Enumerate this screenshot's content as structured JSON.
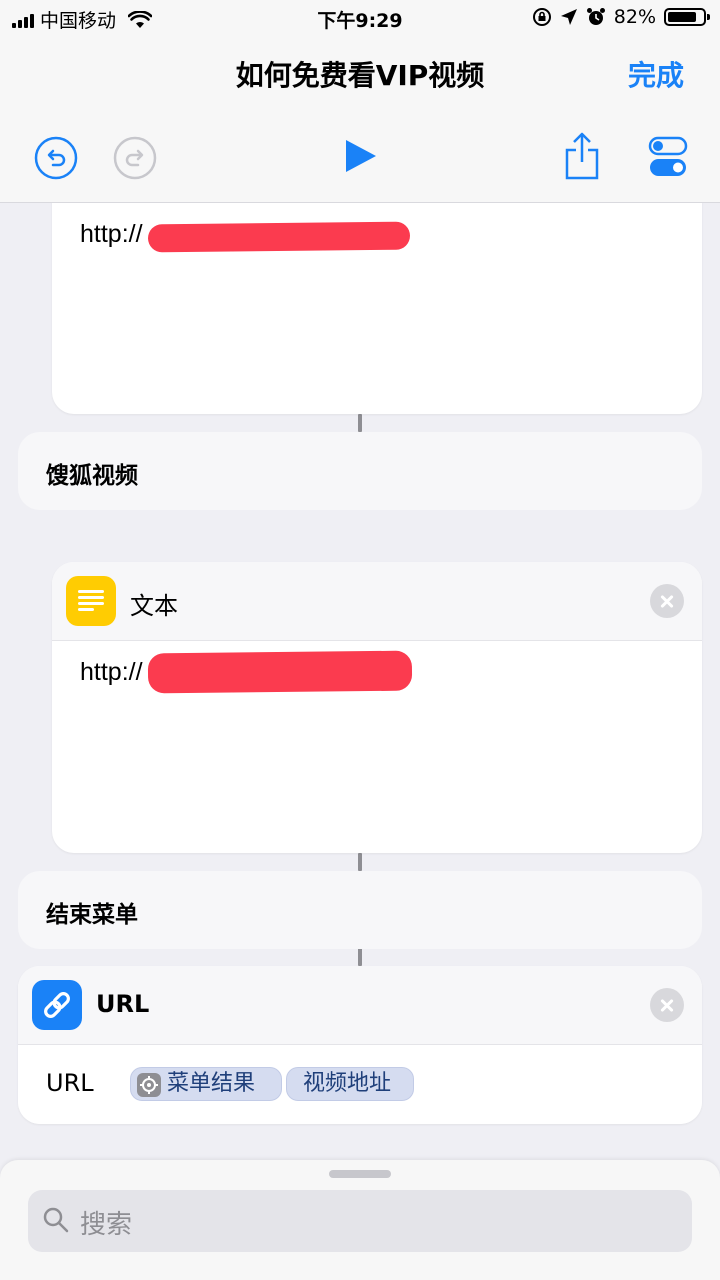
{
  "status": {
    "carrier": "中国移动",
    "time": "下午9:29",
    "battery_percent": "82%",
    "battery_level": 0.82
  },
  "nav": {
    "title": "如何免费看VIP视频",
    "done_label": "完成"
  },
  "toolbar": {
    "undo_icon": "undo-icon",
    "redo_icon": "redo-icon",
    "play_icon": "play-icon",
    "share_icon": "share-icon",
    "settings_icon": "toggles-icon",
    "accent": "#1a82f7"
  },
  "canvas": {
    "text_block_1": {
      "content": "http://"
    },
    "menu_item_1": {
      "label": "馊狐视频"
    },
    "text_action": {
      "title": "文本",
      "icon": "text-lines-icon",
      "icon_color": "#ffcc02",
      "content": "http://"
    },
    "end_menu": {
      "label": "结束菜单"
    },
    "url_action": {
      "title": "URL",
      "icon": "link-icon",
      "icon_color": "#1a82f7",
      "param_label": "URL",
      "tokens": [
        {
          "icon": "gear-icon",
          "label": "菜单结果"
        },
        {
          "label": "视频地址"
        }
      ]
    },
    "redaction_color": "#fb3b4f"
  },
  "bottom_sheet": {
    "search_placeholder": "搜索"
  }
}
